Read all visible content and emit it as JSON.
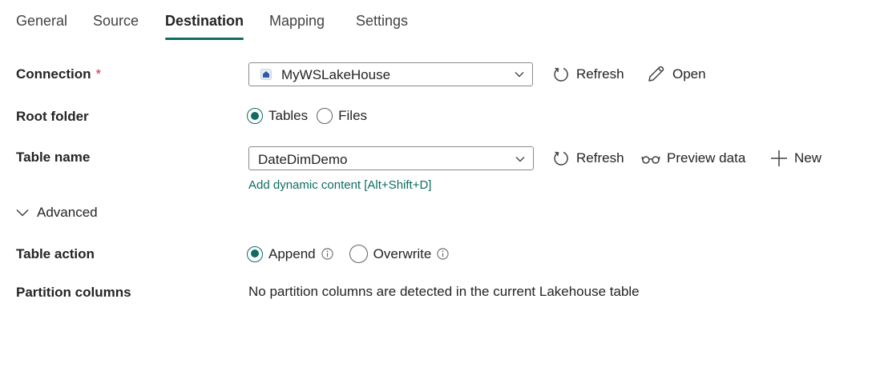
{
  "tabs": [
    {
      "label": "General"
    },
    {
      "label": "Source"
    },
    {
      "label": "Destination"
    },
    {
      "label": "Mapping"
    },
    {
      "label": "Settings"
    }
  ],
  "active_tab": "Destination",
  "connection": {
    "label": "Connection",
    "required_marker": "*",
    "value": "MyWSLakeHouse",
    "refresh_label": "Refresh",
    "open_label": "Open"
  },
  "root_folder": {
    "label": "Root folder",
    "options": [
      "Tables",
      "Files"
    ],
    "selected": "Tables"
  },
  "table_name": {
    "label": "Table name",
    "value": "DateDimDemo",
    "refresh_label": "Refresh",
    "preview_label": "Preview data",
    "new_label": "New",
    "dynamic_link": "Add dynamic content [Alt+Shift+D]"
  },
  "advanced": {
    "label": "Advanced",
    "expanded": true
  },
  "table_action": {
    "label": "Table action",
    "options": [
      "Append",
      "Overwrite"
    ],
    "selected": "Append"
  },
  "partition": {
    "label": "Partition columns",
    "message": "No partition columns are detected in the current Lakehouse table"
  },
  "colors": {
    "accent": "#0f6c63",
    "required": "#c4314b",
    "text": "#242424"
  },
  "icons": {
    "refresh": "refresh-icon",
    "open": "pencil-icon",
    "preview": "glasses-icon",
    "new": "plus-icon",
    "dropdown": "chevron-down-icon",
    "lakehouse": "lakehouse-icon",
    "info": "info-icon"
  }
}
